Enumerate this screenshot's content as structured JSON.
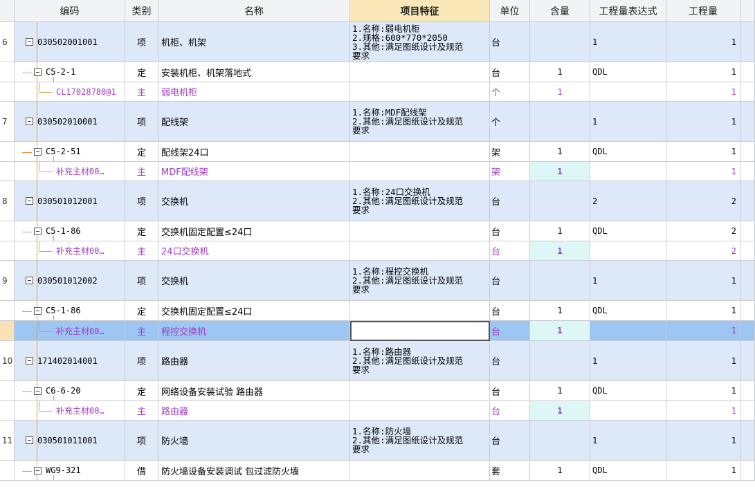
{
  "header": {
    "index": "",
    "code": "编码",
    "category": "类别",
    "name": "名称",
    "features": "项目特征",
    "unit": "单位",
    "content": "含量",
    "expression": "工程量表达式",
    "quantity": "工程量"
  },
  "rows": [
    {
      "type": "xiang",
      "index": "6",
      "code": "030502001001",
      "category": "项",
      "name": "机柜、机架",
      "features": [
        "1.名称:弱电机柜",
        "2.规格:600*770*2050",
        "3.其他:满足图纸设计及规范",
        "要求"
      ],
      "unit": "台",
      "content": "",
      "expression": "1",
      "quantity": "1"
    },
    {
      "type": "ding",
      "index": "",
      "code": "C5-2-1",
      "category": "定",
      "name": "安装机柜、机架落地式",
      "features": [],
      "unit": "台",
      "content": "1",
      "expression": "QDL",
      "quantity": "1"
    },
    {
      "type": "zhu",
      "index": "",
      "code": "CL17028780@1",
      "category": "主",
      "name": "弱电机柜",
      "features": [],
      "unit": "个",
      "content": "1",
      "expression": "",
      "quantity": "1"
    },
    {
      "type": "xiang",
      "index": "7",
      "code": "030502010001",
      "category": "项",
      "name": "配线架",
      "features": [
        "1.名称:MDF配线架",
        "2.其他:满足图纸设计及规范",
        "要求"
      ],
      "unit": "个",
      "content": "",
      "expression": "1",
      "quantity": "1"
    },
    {
      "type": "ding",
      "index": "",
      "code": "C5-2-51",
      "category": "定",
      "name": "配线架24口",
      "features": [],
      "unit": "架",
      "content": "1",
      "expression": "QDL",
      "quantity": "1"
    },
    {
      "type": "zhu",
      "index": "",
      "code": "补充主材00…",
      "category": "主",
      "name": "MDF配线架",
      "features": [],
      "unit": "架",
      "content": "1",
      "expression": "",
      "quantity": "1",
      "highlight": true
    },
    {
      "type": "xiang",
      "index": "8",
      "code": "030501012001",
      "category": "项",
      "name": "交换机",
      "features": [
        "1.名称:24口交换机",
        "2.其他:满足图纸设计及规范",
        "要求"
      ],
      "unit": "台",
      "content": "",
      "expression": "2",
      "quantity": "2"
    },
    {
      "type": "ding",
      "index": "",
      "code": "C5-1-86",
      "category": "定",
      "name": "交换机固定配置≤24口",
      "features": [],
      "unit": "台",
      "content": "1",
      "expression": "QDL",
      "quantity": "2"
    },
    {
      "type": "zhu",
      "index": "",
      "code": "补充主材00…",
      "category": "主",
      "name": "24口交换机",
      "features": [],
      "unit": "台",
      "content": "1",
      "expression": "",
      "quantity": "2",
      "highlight": true
    },
    {
      "type": "xiang",
      "index": "9",
      "code": "030501012002",
      "category": "项",
      "name": "交换机",
      "features": [
        "1.名称:程控交换机",
        "2.其他:满足图纸设计及规范",
        "要求"
      ],
      "unit": "台",
      "content": "",
      "expression": "1",
      "quantity": "1"
    },
    {
      "type": "ding",
      "index": "",
      "code": "C5-1-86",
      "category": "定",
      "name": "交换机固定配置≤24口",
      "features": [],
      "unit": "台",
      "content": "1",
      "expression": "QDL",
      "quantity": "1"
    },
    {
      "type": "sel",
      "index": "",
      "code": "补充主材00…",
      "category": "主",
      "name": "程控交换机",
      "features": [],
      "unit": "台",
      "content": "1",
      "expression": "",
      "quantity": "1",
      "highlight": true
    },
    {
      "type": "xiang",
      "index": "10",
      "code": "171402014001",
      "category": "项",
      "name": "路由器",
      "features": [
        "1.名称:路由器",
        "2.其他:满足图纸设计及规范",
        "要求"
      ],
      "unit": "台",
      "content": "",
      "expression": "1",
      "quantity": "1"
    },
    {
      "type": "ding",
      "index": "",
      "code": "C6-6-20",
      "category": "定",
      "name": "网络设备安装试验 路由器",
      "features": [],
      "unit": "台",
      "content": "1",
      "expression": "QDL",
      "quantity": "1"
    },
    {
      "type": "zhu",
      "index": "",
      "code": "补充主材00…",
      "category": "主",
      "name": "路由器",
      "features": [],
      "unit": "台",
      "content": "1",
      "expression": "",
      "quantity": "1",
      "highlight": true
    },
    {
      "type": "xiang",
      "index": "11",
      "code": "030501011001",
      "category": "项",
      "name": "防火墙",
      "features": [
        "1.名称:防火墙",
        "2.其他:满足图纸设计及规范",
        "要求"
      ],
      "unit": "台",
      "content": "",
      "expression": "1",
      "quantity": "1"
    },
    {
      "type": "ding",
      "index": "",
      "code": "WG9-321",
      "category": "借",
      "name": "防火墙设备安装调试 包过滤防火墙",
      "features": [],
      "unit": "套",
      "content": "1",
      "expression": "QDL",
      "quantity": "1"
    }
  ]
}
